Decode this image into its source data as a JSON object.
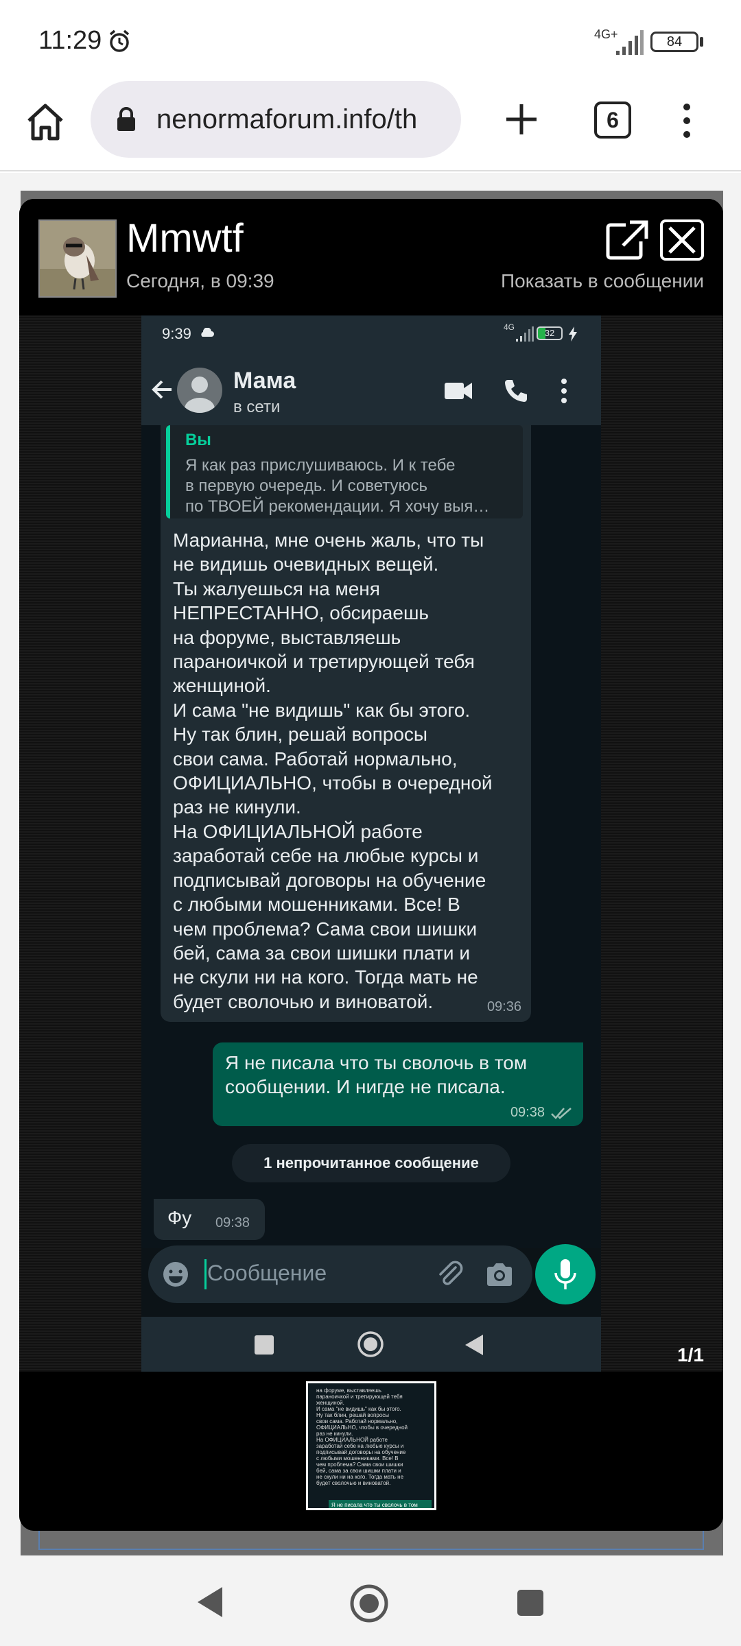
{
  "status_bar": {
    "time": "11:29",
    "network": "4G+",
    "battery": "84"
  },
  "browser": {
    "url": "nenormaforum.info/th",
    "tab_count": "6"
  },
  "lightbox": {
    "user": "Mmwtf",
    "date": "Сегодня, в 09:39",
    "show_in_message": "Показать в сообщении",
    "counter": "1/1"
  },
  "whatsapp": {
    "status_time": "9:39",
    "network": "4G",
    "battery": "32",
    "contact_name": "Мама",
    "presence": "в сети",
    "quote": {
      "author": "Вы",
      "text": "Я как раз прислушиваюсь. И к тебе\nв первую очередь. И советуюсь\nпо ТВОЕЙ рекомендации. Я хочу  выя…"
    },
    "messages": [
      {
        "text": "Марианна, мне очень жаль, что ты\nне видишь очевидных вещей.\nТы жалуешься на меня\nНЕПРЕСТАННО, обсираешь\nна форуме, выставляешь\nпараноичкой и третирующей тебя\nженщиной.\nИ сама \"не видишь\" как бы этого.\nНу так блин, решай вопросы\nсвои сама. Работай нормально,\nОФИЦИАЛЬНО, чтобы в очередной\nраз не кинули.\nНа ОФИЦИАЛЬНОЙ  работе\nзаработай себе на любые курсы и\nподписывай договоры на обучение\nс любыми мошенниками. Все! В\nчем проблема? Сама свои шишки\nбей, сама за свои шишки плати и\nне скули ни на кого. Тогда мать не\nбудет сволочью и виноватой.",
        "time": "09:36"
      },
      {
        "text": "Я не писала что ты сволочь в том\nсообщении. И нигде не писала.",
        "time": "09:38"
      },
      {
        "text": "Фу",
        "time": "09:38"
      }
    ],
    "unread_divider": "1 непрочитанное сообщение",
    "input_placeholder": "Сообщение"
  },
  "thumbnail": {
    "text": "на форуме, выставляешь\nпараноичкой и третирующей тебя\nженщиной.\nИ сама \"не видишь\" как бы этого.\nНу так блин, решай вопросы\nсвои сама. Работай нормально,\nОФИЦИАЛЬНО, чтобы в очередной\nраз не кинули.\nНа ОФИЦИАЛЬНОЙ  работе\nзаработай себе на любые курсы и\nподписывай договоры на обучение\nс любыми мошенниками. Все! В\nчем проблема? Сама свои шишки\nбей, сама за свои шишки плати и\nне скули ни на кого. Тогда мать не\nбудет сволочью и виноватой.",
    "bubble_text": "Я не писала что ты сволочь в том"
  },
  "colors": {
    "wa_accent": "#00a884",
    "wa_out_bubble": "#005c4b",
    "wa_in_bubble": "#202c33"
  }
}
